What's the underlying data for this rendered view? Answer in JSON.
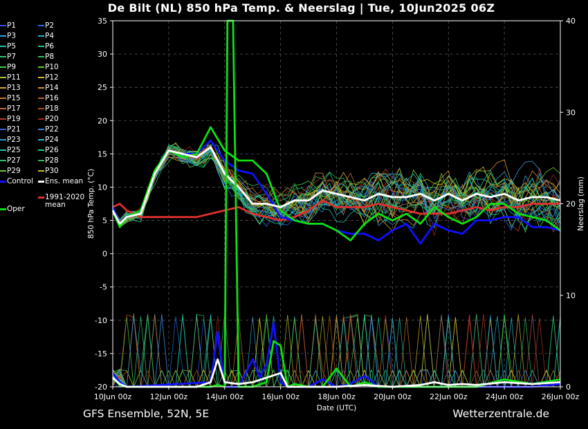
{
  "header": {
    "title": "De Bilt  (NL)  850 hPa Temp. & Neerslag | Tue, 10Jun2025 06Z"
  },
  "footer": {
    "left": "GFS Ensemble, 52N, 5E",
    "right": "Wetterzentrale.de"
  },
  "legend": {
    "members": [
      {
        "label": "P1",
        "color": "#3b4cf0"
      },
      {
        "label": "P2",
        "color": "#1f6fd8"
      },
      {
        "label": "P3",
        "color": "#2aa4e0"
      },
      {
        "label": "P4",
        "color": "#2ab0c8"
      },
      {
        "label": "P5",
        "color": "#20c0b0"
      },
      {
        "label": "P6",
        "color": "#20c890"
      },
      {
        "label": "P7",
        "color": "#30c878"
      },
      {
        "label": "P8",
        "color": "#30c060"
      },
      {
        "label": "P9",
        "color": "#40d040"
      },
      {
        "label": "P10",
        "color": "#58d030"
      },
      {
        "label": "P11",
        "color": "#b0c030"
      },
      {
        "label": "P12",
        "color": "#d0b830"
      },
      {
        "label": "P13",
        "color": "#d8a830"
      },
      {
        "label": "P14",
        "color": "#d09030"
      },
      {
        "label": "P15",
        "color": "#c87830"
      },
      {
        "label": "P16",
        "color": "#b86028"
      },
      {
        "label": "P17",
        "color": "#c06840"
      },
      {
        "label": "P18",
        "color": "#b04a2a"
      },
      {
        "label": "P19",
        "color": "#b03828"
      },
      {
        "label": "P20",
        "color": "#a02818"
      },
      {
        "label": "P21",
        "color": "#4060d8"
      },
      {
        "label": "P22",
        "color": "#2888e0"
      },
      {
        "label": "P23",
        "color": "#30a0d8"
      },
      {
        "label": "P24",
        "color": "#28b8c8"
      },
      {
        "label": "P25",
        "color": "#28c0a8"
      },
      {
        "label": "P26",
        "color": "#20c890"
      },
      {
        "label": "P27",
        "color": "#28c070"
      },
      {
        "label": "P28",
        "color": "#30b858"
      },
      {
        "label": "P29",
        "color": "#70c830"
      },
      {
        "label": "P30",
        "color": "#c8c020"
      }
    ],
    "control": {
      "label": "Control",
      "color": "#1010ff"
    },
    "ens_mean": {
      "label": "Ens. mean",
      "color": "#ffffff"
    },
    "clim_mean": {
      "label": "1991-2020 mean",
      "label1": "1991-2020",
      "label2": "mean",
      "color": "#e03030"
    },
    "oper": {
      "label": "Oper",
      "color": "#10e010"
    }
  },
  "chart_data": {
    "type": "line",
    "xlabel": "Date (UTC)",
    "ylabel": "850 hPa Temp. (°C)",
    "y2label": "Neerslag (mm)",
    "ylim": [
      -20,
      35
    ],
    "y2lim": [
      0,
      40
    ],
    "yticks": [
      35,
      30,
      25,
      20,
      15,
      10,
      5,
      0,
      -5,
      -10,
      -15,
      -20
    ],
    "y2ticks": [
      40,
      30,
      20,
      10,
      0
    ],
    "xlim_days": [
      0,
      16
    ],
    "xticks": [
      "10Jun 00z",
      "12Jun 00z",
      "14Jun 00z",
      "16Jun 00z",
      "18Jun 00z",
      "20Jun 00z",
      "22Jun 00z",
      "24Jun 00z",
      "26Jun 00z"
    ],
    "grid": true,
    "temp_series": [
      {
        "name": "Ens. mean",
        "x": [
          0,
          0.25,
          0.5,
          1,
          1.5,
          2,
          2.5,
          3,
          3.5,
          4,
          4.5,
          5,
          5.5,
          6,
          6.5,
          7,
          7.5,
          8,
          8.5,
          9,
          9.5,
          10,
          10.5,
          11,
          11.5,
          12,
          12.5,
          13,
          13.5,
          14,
          14.5,
          15,
          15.5,
          16
        ],
        "y": [
          6.5,
          4.5,
          5.5,
          6,
          12,
          15.5,
          15,
          14.5,
          16,
          12,
          10,
          7.5,
          7.5,
          7,
          8,
          8,
          9.5,
          9,
          8.5,
          8,
          9,
          8.5,
          8.5,
          9,
          8,
          9,
          8,
          9,
          8.5,
          9,
          8,
          8.5,
          8.5,
          8
        ]
      },
      {
        "name": "Control",
        "x": [
          0,
          0.25,
          0.5,
          1,
          1.5,
          2,
          2.5,
          3,
          3.5,
          4,
          4.5,
          5,
          5.5,
          6,
          6.5,
          7,
          7.5,
          8,
          8.5,
          9,
          9.5,
          10,
          10.5,
          11,
          11.5,
          12,
          12.5,
          13,
          13.5,
          14,
          14.5,
          15,
          15.5,
          16
        ],
        "y": [
          7,
          4.5,
          5.5,
          6,
          12,
          15.5,
          15,
          15,
          17,
          14,
          12.5,
          12,
          9,
          5.5,
          5,
          4.5,
          4.5,
          3.5,
          3,
          3,
          2,
          3.5,
          4.5,
          1.5,
          4.5,
          3.5,
          3,
          5,
          5,
          5.5,
          5.5,
          4,
          4,
          3.5
        ]
      },
      {
        "name": "Oper",
        "x": [
          0,
          0.25,
          0.5,
          1,
          1.5,
          2,
          2.5,
          3,
          3.5,
          4,
          4.5,
          5,
          5.5,
          6,
          6.5,
          7,
          7.5,
          8,
          8.5,
          9,
          9.5,
          10,
          10.5,
          11,
          11.5,
          12,
          12.5,
          13,
          13.5,
          14,
          14.5,
          15,
          15.5,
          16
        ],
        "y": [
          6.5,
          4,
          5.5,
          6.5,
          12.5,
          15.5,
          14.5,
          15,
          19,
          15.5,
          14,
          14,
          12,
          6.5,
          5,
          4.5,
          4.5,
          3.5,
          2,
          4.5,
          6,
          5,
          6,
          4.5,
          7,
          5.5,
          4.5,
          5.5,
          7.5,
          7.5,
          6,
          5.5,
          5,
          3.5
        ]
      },
      {
        "name": "1991-2020 mean",
        "x": [
          0,
          0.25,
          0.5,
          1,
          1.5,
          2,
          2.5,
          3,
          3.5,
          4,
          4.5,
          5,
          5.5,
          6,
          6.5,
          7,
          7.5,
          8,
          8.5,
          9,
          9.5,
          10,
          10.5,
          11,
          11.5,
          12,
          12.5,
          13,
          13.5,
          14,
          14.5,
          15,
          15.5,
          16
        ],
        "y": [
          7,
          7.5,
          6.5,
          5.5,
          5.5,
          5.5,
          5.5,
          5.5,
          6,
          6.5,
          7,
          6,
          5.5,
          5,
          5.5,
          6.5,
          8,
          7,
          7,
          7,
          7.5,
          7,
          6.5,
          6,
          6,
          6,
          6.5,
          7,
          6.5,
          7,
          7,
          7.5,
          7.5,
          7.5
        ]
      }
    ],
    "precip_series": [
      {
        "name": "Control",
        "x": [
          0,
          0.25,
          0.5,
          3.5,
          3.75,
          4,
          4.5,
          5,
          5.25,
          5.5,
          5.75,
          6,
          6.25,
          6.5,
          7,
          7.5,
          8,
          8.5,
          9,
          9.5,
          10,
          11,
          12,
          13,
          14,
          15,
          16
        ],
        "y": [
          1.5,
          0.5,
          0,
          0.5,
          6,
          0,
          0,
          3,
          1,
          2.5,
          7,
          0.5,
          0,
          0,
          0,
          0.8,
          0,
          0.3,
          1.2,
          0,
          0,
          0,
          0,
          0,
          0,
          0,
          0.3
        ]
      },
      {
        "name": "Oper",
        "x": [
          0,
          0.25,
          0.5,
          3.5,
          3.75,
          4,
          4.1,
          4.3,
          4.5,
          5,
          5.5,
          5.75,
          6,
          6.25,
          6.5,
          7,
          7.5,
          8,
          8.5,
          9,
          9.5,
          10,
          11,
          12,
          13,
          14,
          15,
          16
        ],
        "y": [
          1,
          0.2,
          0,
          0,
          0.2,
          0,
          40,
          40,
          0,
          0,
          0.5,
          5,
          4.5,
          0,
          0.3,
          0,
          0,
          2,
          0,
          0.5,
          0,
          0,
          0,
          0,
          0,
          0.8,
          0.3,
          0.8
        ]
      },
      {
        "name": "Ens. mean",
        "x": [
          0,
          0.25,
          0.5,
          3,
          3.5,
          3.75,
          4,
          4.5,
          5,
          5.5,
          6,
          6.25,
          6.5,
          7,
          8,
          9,
          10,
          11,
          11.5,
          12,
          12.5,
          13,
          14,
          15,
          16
        ],
        "y": [
          1,
          0.3,
          0,
          0,
          0.5,
          3,
          0.5,
          0.3,
          0.5,
          1,
          1.5,
          0,
          0,
          0,
          0,
          0.2,
          0,
          0.2,
          0.5,
          0.2,
          0.3,
          0.2,
          0.5,
          0.3,
          0.5
        ]
      }
    ]
  }
}
